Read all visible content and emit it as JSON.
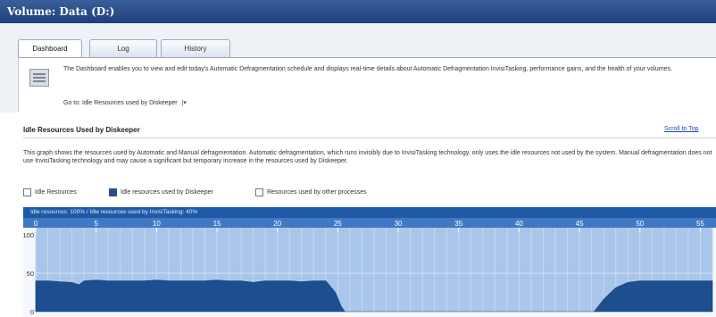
{
  "window": {
    "title": "Volume: Data (D:)"
  },
  "tabs": [
    {
      "label": "Dashboard",
      "active": true
    },
    {
      "label": "Log",
      "active": false
    },
    {
      "label": "History",
      "active": false
    }
  ],
  "dashboard": {
    "icon": "dashboard-icon",
    "description": "The Dashboard enables you to view and edit today's Automatic Defragmentation schedule and displays real-time details about Automatic Defragmentation InvisiTasking, performance gains, and the health of your volumes.",
    "goto_label": "Go to: Idle Resources used by Diskeeper"
  },
  "section": {
    "title": "Idle Resources Used by Diskeeper",
    "scroll_link": "Scroll to Top",
    "paragraph": "This graph shows the resources used by Automatic and Manual defragmentation. Automatic defragmentation, which runs invisibly due to InvisiTasking technology, only uses the idle resources not used by the system. Manual defragmentation does not use InvisiTasking technology and may cause a significant but temporary increase in the resources used by Diskeeper."
  },
  "legend": [
    {
      "label": "Idle Resources",
      "checked": false
    },
    {
      "label": "Idle resources used by Diskeeper",
      "checked": true
    },
    {
      "label": "Resources used by other processes",
      "checked": false
    }
  ],
  "chart_header": "Idle resources: 100% / Idle resources used by InvisiTasking: 40%",
  "chart_data": {
    "type": "area",
    "x_ticks": [
      0,
      5,
      10,
      15,
      20,
      25,
      30,
      35,
      40,
      45,
      50,
      55
    ],
    "y_ticks": [
      100,
      50,
      0
    ],
    "ylim": [
      0,
      100
    ],
    "xlim": [
      0,
      56
    ],
    "series": [
      {
        "name": "Idle resources used by Diskeeper",
        "x": [
          0,
          1,
          2,
          3,
          3.6,
          4,
          5,
          6,
          7,
          8,
          9,
          10,
          11,
          12,
          13,
          14,
          15,
          16,
          17,
          18,
          19,
          20,
          21,
          22,
          23,
          24,
          24.8,
          25.3,
          25.6,
          46.2,
          47,
          48,
          49,
          50,
          51,
          52,
          53,
          54,
          55,
          56
        ],
        "y": [
          40,
          40,
          39,
          38,
          35,
          40,
          41,
          40,
          40,
          40,
          40,
          41,
          40,
          40,
          40,
          40,
          41,
          40,
          40,
          38,
          40,
          40,
          40,
          39,
          40,
          40,
          25,
          6,
          0,
          0,
          16,
          31,
          38,
          40,
          40,
          40,
          40,
          40,
          40,
          40
        ]
      }
    ],
    "colors": {
      "area": "#1d4e8f",
      "background": "#a9c5ea",
      "axis_band": "#3f79c4"
    }
  }
}
